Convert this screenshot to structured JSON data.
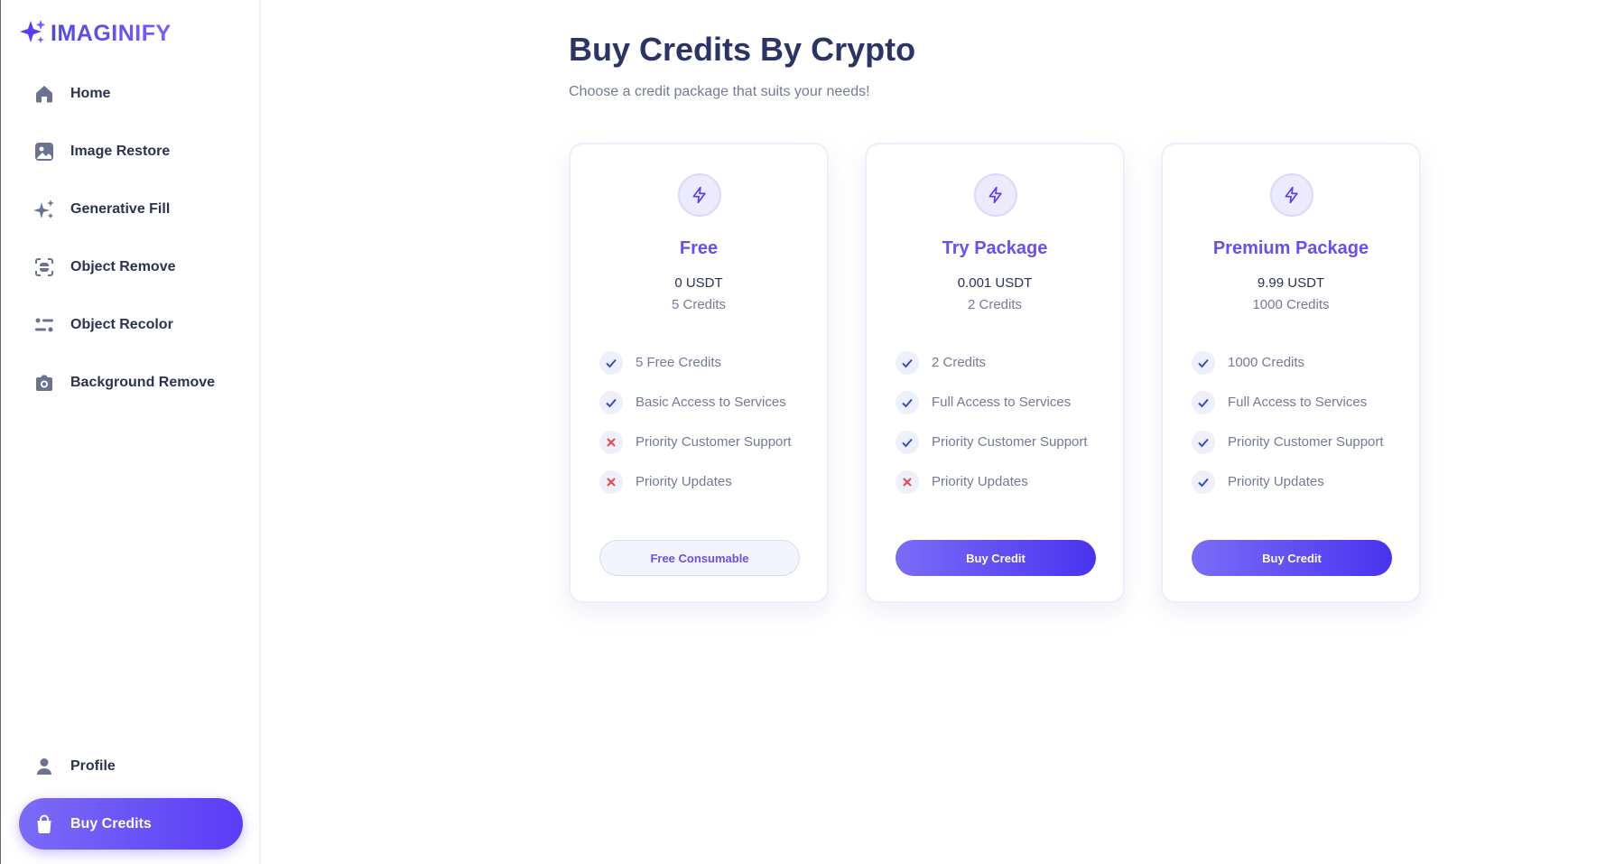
{
  "app": {
    "name": "IMAGINIFY"
  },
  "sidebar": {
    "items": [
      {
        "label": "Home",
        "icon": "home-icon"
      },
      {
        "label": "Image Restore",
        "icon": "image-icon"
      },
      {
        "label": "Generative Fill",
        "icon": "sparkles-icon"
      },
      {
        "label": "Object Remove",
        "icon": "scan-icon"
      },
      {
        "label": "Object Recolor",
        "icon": "filter-icon"
      },
      {
        "label": "Background Remove",
        "icon": "camera-icon"
      }
    ],
    "bottom_items": [
      {
        "label": "Profile",
        "icon": "user-icon"
      },
      {
        "label": "Buy Credits",
        "icon": "bag-icon",
        "active": true
      }
    ]
  },
  "page": {
    "title": "Buy Credits By Crypto",
    "subtitle": "Choose a credit package that suits your needs!"
  },
  "plans": [
    {
      "name": "Free",
      "price": "0 USDT",
      "credits": "5 Credits",
      "features": [
        {
          "text": "5 Free Credits",
          "included": true
        },
        {
          "text": "Basic Access to Services",
          "included": true
        },
        {
          "text": "Priority Customer Support",
          "included": false
        },
        {
          "text": "Priority Updates",
          "included": false
        }
      ],
      "button": "Free Consumable"
    },
    {
      "name": "Try Package",
      "price": "0.001 USDT",
      "credits": "2 Credits",
      "features": [
        {
          "text": "2 Credits",
          "included": true
        },
        {
          "text": "Full Access to Services",
          "included": true
        },
        {
          "text": "Priority Customer Support",
          "included": true
        },
        {
          "text": "Priority Updates",
          "included": false
        }
      ],
      "button": "Buy Credit"
    },
    {
      "name": "Premium Package",
      "price": "9.99 USDT",
      "credits": "1000 Credits",
      "features": [
        {
          "text": "1000 Credits",
          "included": true
        },
        {
          "text": "Full Access to Services",
          "included": true
        },
        {
          "text": "Priority Customer Support",
          "included": true
        },
        {
          "text": "Priority Updates",
          "included": true
        }
      ],
      "button": "Buy Credit"
    }
  ],
  "colors": {
    "accent": "#6d4cf2",
    "title": "#2a3566",
    "check": "#3b4cc0",
    "cross": "#e5484d"
  }
}
